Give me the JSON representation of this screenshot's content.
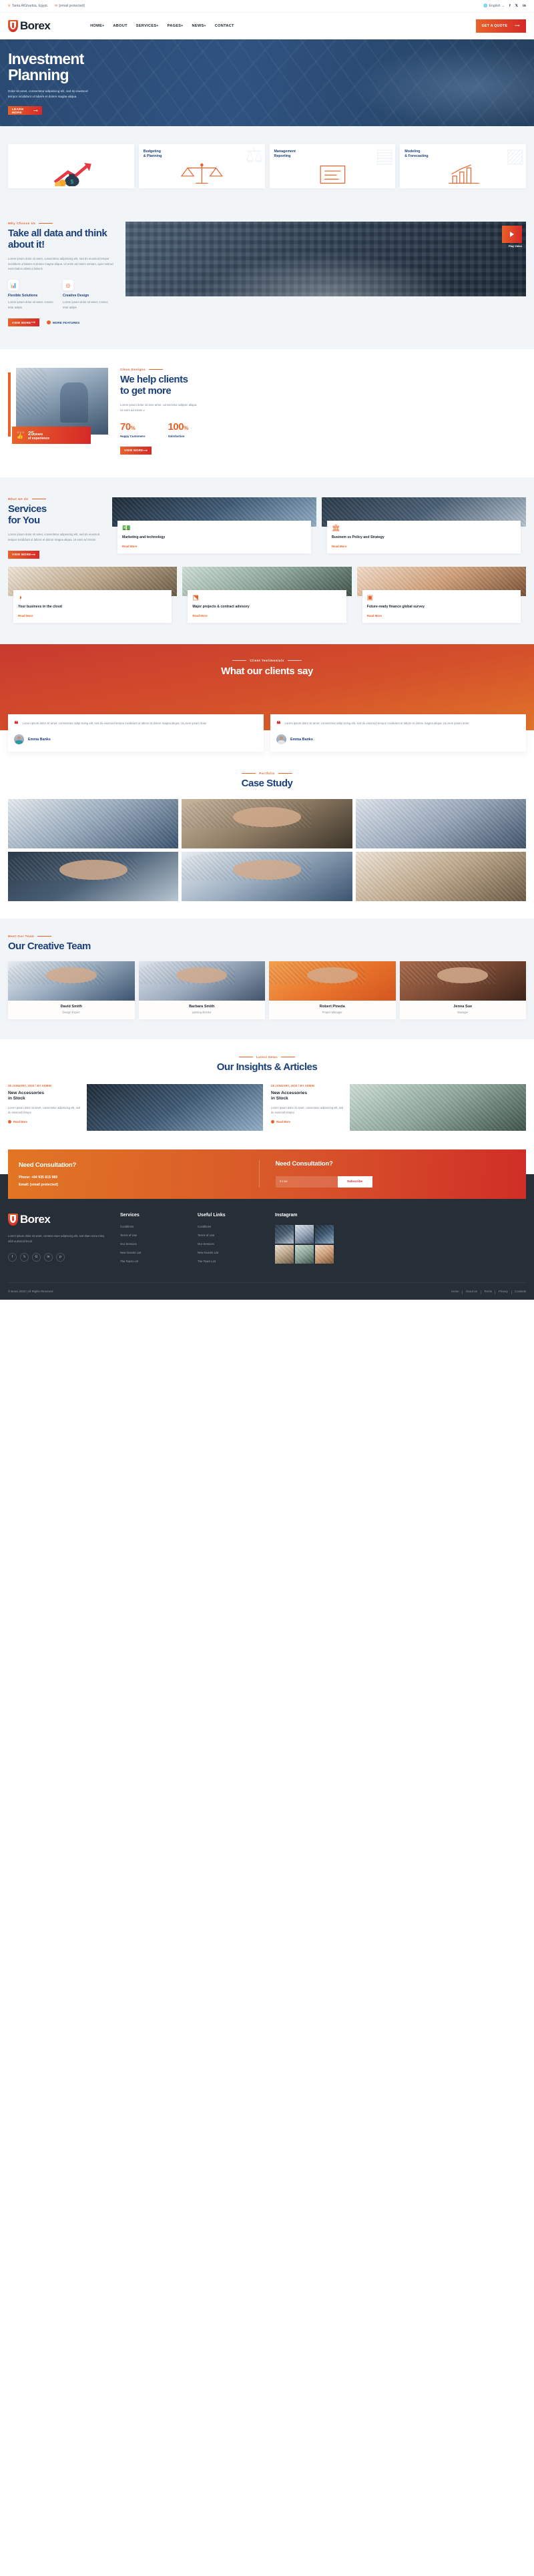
{
  "brand": {
    "name": "Borex",
    "accent_orange": "#e8632a",
    "accent_red": "#d62828",
    "navy": "#1b4079"
  },
  "topbar": {
    "location": "Tanta AlGharbia, Egypt.",
    "email": "[email protected]",
    "language": "English",
    "socials": [
      "f",
      "t",
      "in"
    ]
  },
  "nav": {
    "items": [
      {
        "label": "HOME",
        "caret": "+"
      },
      {
        "label": "ABOUT",
        "caret": ""
      },
      {
        "label": "SERVICES",
        "caret": "+"
      },
      {
        "label": "PAGES",
        "caret": "+"
      },
      {
        "label": "NEWS",
        "caret": "+"
      },
      {
        "label": "CONTACT",
        "caret": ""
      }
    ],
    "quote_button": "GET A QUOTE"
  },
  "hero": {
    "title_line1": "Investment",
    "title_line2": "Planning",
    "subtitle": "Dolor sit amet, consectetur adipisicing elit, sed do eiusmod tempor incididunt ut labore et dolore magna aliqua.",
    "button": "LEARN MORE"
  },
  "features": [
    {
      "title_line1": "",
      "title_line2": "",
      "icon": "money-bag-growth-icon",
      "art": "bag"
    },
    {
      "title_line1": "Budgeting",
      "title_line2": "& Planning",
      "icon": "scales-icon",
      "art": "scales"
    },
    {
      "title_line1": "Management",
      "title_line2": "Reporting",
      "icon": "report-icon",
      "art": "report"
    },
    {
      "title_line1": "Modeling",
      "title_line2": "& Forecasting",
      "icon": "forecast-chart-icon",
      "art": "chart"
    }
  ],
  "why": {
    "eyebrow": "Why Choose Us",
    "title": "Take all data and think about it!",
    "body": "Lorem ipsum dolor sit amet, consectetur adipisicing elit, sed do eiusmod tempor incididunt ut labore et dolore magna aliqua. Ut enim ad minim veniam, quis nostrud exercitation ullamco laboris",
    "minis": [
      {
        "icon": "bar-chart-icon",
        "title": "Flexible Solutions",
        "body": "Lorem ipsum dolor sit amet, consec tetur adipis"
      },
      {
        "icon": "coin-icon",
        "title": "Creative Design",
        "body": "Lorem ipsum dolor sit amet, consec tetur adipis"
      }
    ],
    "button": "VIEW MORE",
    "more_link": "MORE FEATURES",
    "video_label": "Play Video"
  },
  "help": {
    "eyebrow": "Clean Designs",
    "title_line1": "We help clients",
    "title_line2": "to get more",
    "body": "Lorem ipsum dolor sit ame amet, consectetur adipisic aliqua. Ut enim ad minim v",
    "stats": [
      {
        "value": "70",
        "unit": "%",
        "label": "Happy Customers"
      },
      {
        "value": "100",
        "unit": "%",
        "label": "Satisfaction"
      }
    ],
    "button": "VIEW MORE",
    "badge": {
      "stars": "☆☆☆",
      "number": "25",
      "unit": "years",
      "sub": "of experience"
    }
  },
  "services": {
    "eyebrow": "What we do",
    "title_line1": "Services",
    "title_line2": "for You",
    "body": "Lorem ipsum dolor sit amet, consectetur adipisicing elit, sed do eiusmod tempor incididunt ut labore et dolore magna aliqua. Ut enim ad minim",
    "button": "VIEW MORE",
    "read_more": "Read More",
    "cards": [
      {
        "title": "Marketing and technology",
        "icon": "banknote-icon",
        "photo": "hands-holding-cash"
      },
      {
        "title": "Businem ss Policy and Strategy",
        "icon": "building-icon",
        "photo": "trading-screens"
      },
      {
        "title": "Your business in the cloud",
        "icon": "pie-chart-icon",
        "photo": "business-newspaper"
      },
      {
        "title": "Major projects & contract advisory",
        "icon": "boxes-icon",
        "photo": "signing-document"
      },
      {
        "title": "Future-ready finance global survey",
        "icon": "presentation-chart-icon",
        "photo": "card-and-laptop"
      }
    ]
  },
  "testimonials": {
    "eyebrow": "Client Testimonials",
    "title": "What our clients say",
    "items": [
      {
        "quote": "Lorem ipsum dolor sit amet, consectetur adipi sicing elit, sed do eiusmod tempor incididunt ut labore et dolore magna aliqua. ULorem ipsum dolor",
        "name": "Emma Banks"
      },
      {
        "quote": "Lorem ipsum dolor sit amet, consectetur adipi sicing elit, sed do eiusmod tempor incididunt ut labore et dolore magna aliqua. ULorem ipsum dolor",
        "name": "Emma Banks"
      }
    ]
  },
  "case_study": {
    "eyebrow": "Portfolio",
    "title": "Case Study",
    "cells": [
      "team-meeting-handshake",
      "man-with-laptop-plaid",
      "analytics-dashboard",
      "businessman-portrait",
      "two-men-discussion",
      "hands-on-laptop"
    ]
  },
  "team": {
    "eyebrow": "Meet Our Team",
    "title": "Our Creative Team",
    "members": [
      {
        "name": "David Smith",
        "role": "Design Expert"
      },
      {
        "name": "Barbara Smith",
        "role": "painting director"
      },
      {
        "name": "Robert Pineda",
        "role": "Project Manager"
      },
      {
        "name": "Jenna Sue",
        "role": "Manager"
      }
    ]
  },
  "blog": {
    "eyebrow": "Latest News",
    "title": "Our Insights & Articles",
    "read_more": "Read More",
    "posts": [
      {
        "date": "28 JANUARY, 2020 / BY ADMIN",
        "title_line1": "New Accessories",
        "title_line2": "in Stock",
        "excerpt": "Lorem ipsum dolor sit amet, consectetur adipisicing elit, sed do eiusmod tempor",
        "photo": "phone-with-charts"
      },
      {
        "date": "28 JANUARY, 2020 / BY ADMIN",
        "title_line1": "New Accessories",
        "title_line2": "in Stock",
        "excerpt": "Lorem ipsum dolor sit amet, consectetur adipisicing elit, sed do eiusmod tempor",
        "photo": "hands-fanning-cash"
      }
    ]
  },
  "cta": {
    "left_title": "Need Consultation?",
    "phone": "Phone: +84 935 815 989",
    "email": "Email: [email protected]",
    "right_title": "Need Consultation?",
    "email_placeholder": "Email",
    "subscribe_button": "Subscribe"
  },
  "footer": {
    "brand": "Borex",
    "description": "Lorem ipsum dolor sit amet, consect etuer adipiscing elit, sed diam nonu mmy nibh euismod tincid",
    "socials": [
      "f",
      "t",
      "G",
      "in",
      "p"
    ],
    "columns": [
      {
        "heading": "Services",
        "links": [
          "Conditions",
          "Terms of Use",
          "Our Services",
          "New Guests List",
          "The Team List"
        ]
      },
      {
        "heading": "Useful Links",
        "links": [
          "Conditions",
          "Terms of Use",
          "Our Services",
          "New Guests List",
          "The Team List"
        ]
      }
    ],
    "instagram_heading": "Instagram",
    "instagram_cells": [
      "ig-1",
      "ig-2",
      "ig-3",
      "ig-4",
      "ig-5",
      "ig-6"
    ],
    "copyright": "© Borex 2020 | All Rights Reserved",
    "bottom_links": [
      "Home",
      "About Us",
      "Terms",
      "Privacy",
      "Contacts"
    ]
  }
}
